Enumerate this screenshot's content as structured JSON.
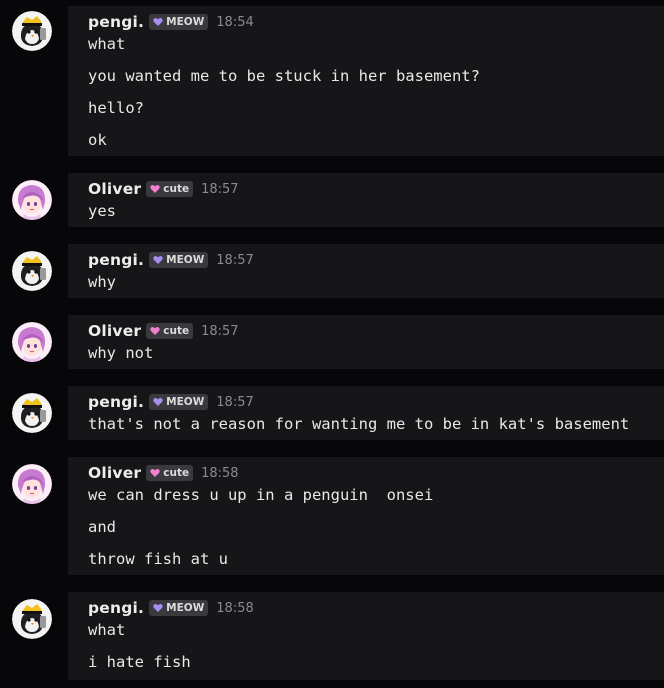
{
  "users": {
    "pengi": {
      "name": "pengi.",
      "badge": "MEOW",
      "badge_heart_color": "#a98cf2"
    },
    "oliver": {
      "name": "Oliver",
      "badge": "cute",
      "badge_heart_color": "#f27fcf"
    }
  },
  "messages": [
    {
      "author": "pengi.",
      "badge": "MEOW",
      "time": "18:54",
      "lines": [
        "what",
        "you wanted me to be stuck in her basement?",
        "hello?",
        "ok"
      ]
    },
    {
      "author": "Oliver",
      "badge": "cute",
      "time": "18:57",
      "lines": [
        "yes"
      ]
    },
    {
      "author": "pengi.",
      "badge": "MEOW",
      "time": "18:57",
      "lines": [
        "why"
      ]
    },
    {
      "author": "Oliver",
      "badge": "cute",
      "time": "18:57",
      "lines": [
        "why not"
      ]
    },
    {
      "author": "pengi.",
      "badge": "MEOW",
      "time": "18:57",
      "lines": [
        "that's not a reason for wanting me to be in kat's basement"
      ]
    },
    {
      "author": "Oliver",
      "badge": "cute",
      "time": "18:58",
      "lines": [
        "we can dress u up in a penguin  onsei",
        "and",
        "throw fish at u"
      ]
    },
    {
      "author": "pengi.",
      "badge": "MEOW",
      "time": "18:58",
      "lines": [
        "what",
        "i hate fish"
      ]
    }
  ]
}
